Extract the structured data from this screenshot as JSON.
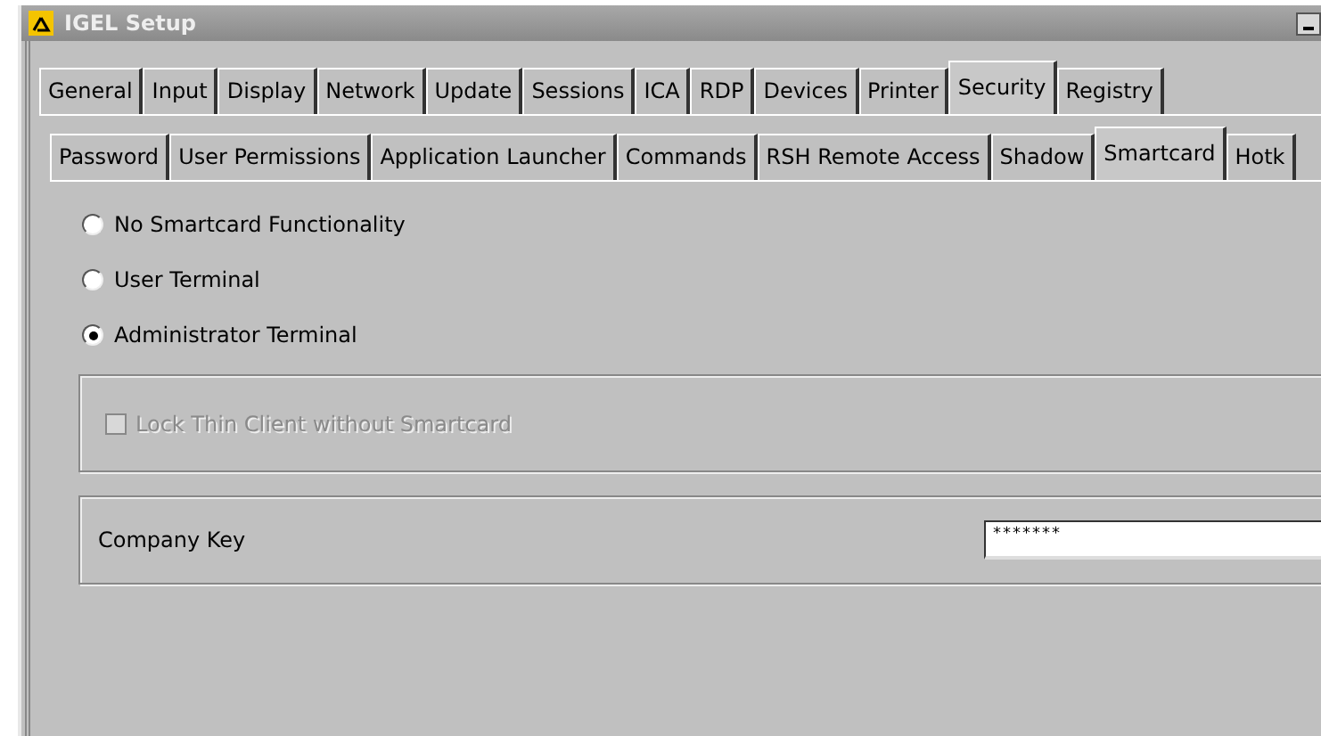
{
  "window": {
    "title": "IGEL Setup"
  },
  "tabs": [
    {
      "label": "General",
      "selected": false
    },
    {
      "label": "Input",
      "selected": false
    },
    {
      "label": "Display",
      "selected": false
    },
    {
      "label": "Network",
      "selected": false
    },
    {
      "label": "Update",
      "selected": false
    },
    {
      "label": "Sessions",
      "selected": false
    },
    {
      "label": "ICA",
      "selected": false
    },
    {
      "label": "RDP",
      "selected": false
    },
    {
      "label": "Devices",
      "selected": false
    },
    {
      "label": "Printer",
      "selected": false
    },
    {
      "label": "Security",
      "selected": true
    },
    {
      "label": "Registry",
      "selected": false
    }
  ],
  "subtabs": [
    {
      "label": "Password",
      "selected": false
    },
    {
      "label": "User Permissions",
      "selected": false
    },
    {
      "label": "Application Launcher",
      "selected": false
    },
    {
      "label": "Commands",
      "selected": false
    },
    {
      "label": "RSH Remote Access",
      "selected": false
    },
    {
      "label": "Shadow",
      "selected": false
    },
    {
      "label": "Smartcard",
      "selected": true
    },
    {
      "label": "Hotk",
      "selected": false
    }
  ],
  "radios": [
    {
      "label": "No Smartcard Functionality",
      "selected": false
    },
    {
      "label": "User Terminal",
      "selected": false
    },
    {
      "label": "Administrator Terminal",
      "selected": true
    }
  ],
  "lock_option": {
    "label": "Lock Thin Client without Smartcard",
    "checked": false,
    "disabled": true
  },
  "company_key": {
    "label": "Company Key",
    "value": "*******"
  }
}
